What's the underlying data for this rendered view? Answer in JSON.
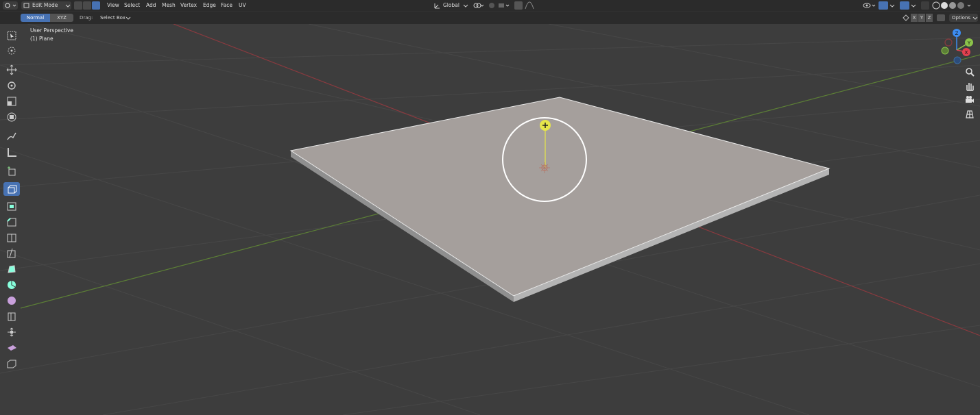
{
  "header": {
    "mode_label": "Edit Mode",
    "menus": [
      "View",
      "Select",
      "Add",
      "Mesh",
      "Vertex",
      "Edge",
      "Face",
      "UV"
    ],
    "orientation_label": "Global"
  },
  "tool_settings": {
    "normal_label": "Normal",
    "xyz_label": "XYZ",
    "drag_label": "Drag:",
    "select_box_label": "Select Box",
    "axis_labels": [
      "X",
      "Y",
      "Z"
    ],
    "options_label": "Options"
  },
  "viewport": {
    "view_name": "User Perspective",
    "object_name": "(1) Plane"
  },
  "gizmo": {
    "z_label": "Z",
    "y_label": "Y",
    "x_label": "X"
  },
  "colors": {
    "accent": "#4772b3",
    "x_axis": "#e2404f",
    "y_axis": "#8bc34a",
    "z_axis": "#3d8df0",
    "plane_top": "#a59f9c",
    "grid_line": "#4a4a4a"
  },
  "toolbar_icons": [
    "select-box-icon",
    "cursor-icon",
    "move-icon",
    "rotate-icon",
    "scale-icon",
    "transform-icon",
    "annotate-icon",
    "measure-icon",
    "add-cube-icon",
    "extrude-region-icon",
    "inset-faces-icon",
    "bevel-icon",
    "loop-cut-icon",
    "knife-icon",
    "poly-build-icon",
    "spin-icon",
    "smooth-icon",
    "edge-slide-icon",
    "shrink-fatten-icon",
    "shear-icon",
    "rip-region-icon"
  ]
}
